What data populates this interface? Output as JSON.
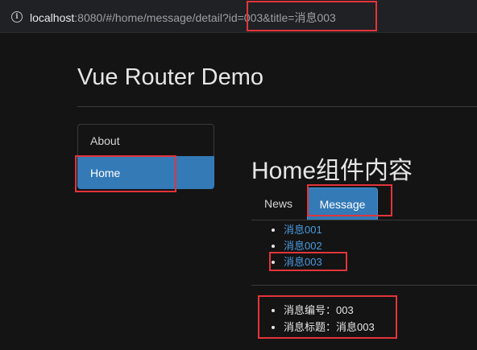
{
  "browser": {
    "url_host": "localhost",
    "url_rest": ":8080/#/home/message/detail?id=003&title=消息003"
  },
  "app": {
    "title": "Vue Router Demo"
  },
  "sidebar": {
    "items": [
      {
        "label": "About"
      },
      {
        "label": "Home"
      }
    ]
  },
  "main": {
    "title": "Home组件内容",
    "tabs": [
      {
        "label": "News"
      },
      {
        "label": "Message"
      }
    ],
    "messages": [
      {
        "label": "消息001"
      },
      {
        "label": "消息002"
      },
      {
        "label": "消息003"
      }
    ],
    "detail": {
      "id_line": "消息编号：003",
      "title_line": "消息标题：消息003"
    }
  },
  "colors": {
    "background": "#141414",
    "active": "#337ab7",
    "link": "#4a9be0",
    "highlight": "#e3343b"
  }
}
